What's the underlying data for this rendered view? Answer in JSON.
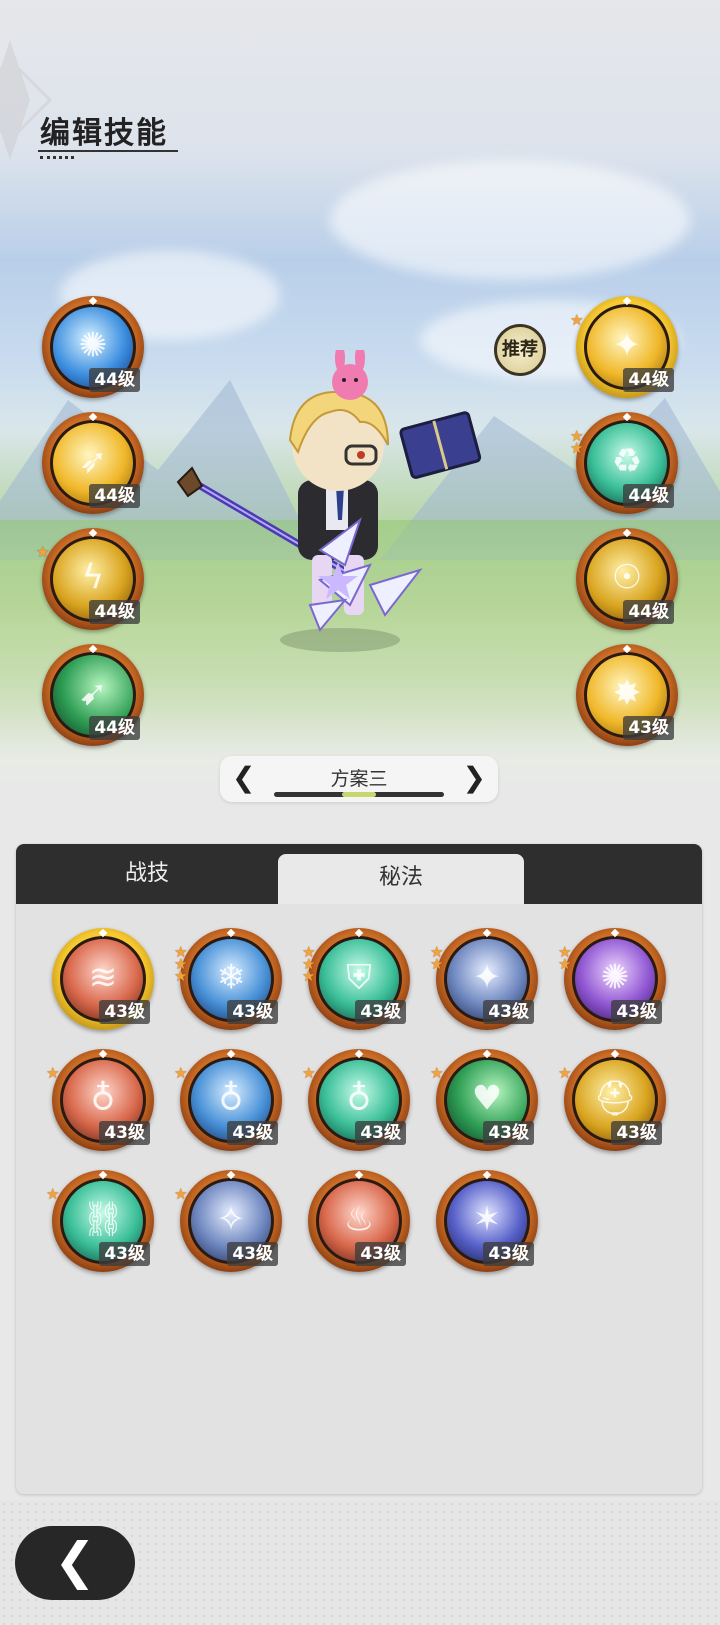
{
  "header": {
    "title": "编辑技能"
  },
  "recommend_label": "推荐",
  "left_skills": [
    {
      "name": "ice-burst-skill-icon",
      "level": "44级",
      "color": "c-ice",
      "frame": "bronze",
      "stars": 0,
      "glyph": "✺"
    },
    {
      "name": "golden-arrow-skill-icon",
      "level": "44级",
      "color": "c-gold",
      "frame": "bronze",
      "stars": 0,
      "glyph": "➶"
    },
    {
      "name": "lightning-slash-skill-icon",
      "level": "44级",
      "color": "c-gold2",
      "frame": "bronze",
      "stars": 1,
      "glyph": "ϟ"
    },
    {
      "name": "wind-blade-skill-icon",
      "level": "44级",
      "color": "c-green",
      "frame": "bronze",
      "stars": 0,
      "glyph": "➹"
    }
  ],
  "right_skills": [
    {
      "name": "light-feather-skill-icon",
      "level": "44级",
      "color": "c-gold",
      "frame": "gold",
      "stars": 1,
      "glyph": "✦"
    },
    {
      "name": "green-cycle-skill-icon",
      "level": "44级",
      "color": "c-teal",
      "frame": "bronze",
      "stars": 2,
      "glyph": "♻"
    },
    {
      "name": "summon-figure-skill-icon",
      "level": "44级",
      "color": "c-gold2",
      "frame": "bronze",
      "stars": 0,
      "glyph": "☉"
    },
    {
      "name": "radiant-burst-skill-icon",
      "level": "43级",
      "color": "c-gold",
      "frame": "bronze",
      "stars": 0,
      "glyph": "✸"
    }
  ],
  "scheme": {
    "prev": "❮",
    "label": "方案三",
    "next": "❯"
  },
  "tabs": [
    {
      "label": "战技",
      "active": false
    },
    {
      "label": "秘法",
      "active": true
    }
  ],
  "arcana": [
    {
      "name": "red-wave-rune-icon",
      "level": "43级",
      "color": "c-red",
      "frame": "gold",
      "stars": 0,
      "glyph": "≋"
    },
    {
      "name": "ice-crystal-rune-icon",
      "level": "43级",
      "color": "c-blue",
      "frame": "bronze",
      "stars": 3,
      "glyph": "❄"
    },
    {
      "name": "green-shield-rune-icon",
      "level": "43级",
      "color": "c-teal",
      "frame": "bronze",
      "stars": 3,
      "glyph": "⛨"
    },
    {
      "name": "star-spark-rune-icon",
      "level": "43级",
      "color": "c-slate",
      "frame": "bronze",
      "stars": 2,
      "glyph": "✦"
    },
    {
      "name": "purple-vortex-rune-icon",
      "level": "43级",
      "color": "c-purple",
      "frame": "bronze",
      "stars": 2,
      "glyph": "✺"
    },
    {
      "name": "red-figure-rune-icon",
      "level": "43级",
      "color": "c-red",
      "frame": "bronze",
      "stars": 1,
      "glyph": "♁"
    },
    {
      "name": "blue-figure-rune-icon",
      "level": "43级",
      "color": "c-blue",
      "frame": "bronze",
      "stars": 1,
      "glyph": "♁"
    },
    {
      "name": "green-figure-rune-icon",
      "level": "43级",
      "color": "c-teal",
      "frame": "bronze",
      "stars": 1,
      "glyph": "♁"
    },
    {
      "name": "green-heart-rune-icon",
      "level": "43级",
      "color": "c-green",
      "frame": "bronze",
      "stars": 1,
      "glyph": "♥"
    },
    {
      "name": "golden-helm-rune-icon",
      "level": "43级",
      "color": "c-gold2",
      "frame": "bronze",
      "stars": 1,
      "glyph": "⛑"
    },
    {
      "name": "green-chain-rune-icon",
      "level": "43级",
      "color": "c-teal",
      "frame": "bronze",
      "stars": 1,
      "glyph": "⛓"
    },
    {
      "name": "blue-armor-rune-icon",
      "level": "43级",
      "color": "c-slate",
      "frame": "bronze",
      "stars": 1,
      "glyph": "✧"
    },
    {
      "name": "red-flame-rune-icon",
      "level": "43级",
      "color": "c-red",
      "frame": "bronze",
      "stars": 0,
      "glyph": "♨"
    },
    {
      "name": "night-sky-rune-icon",
      "level": "43级",
      "color": "c-night",
      "frame": "bronze",
      "stars": 0,
      "glyph": "✶"
    }
  ],
  "back_button": {
    "glyph": "❮"
  }
}
